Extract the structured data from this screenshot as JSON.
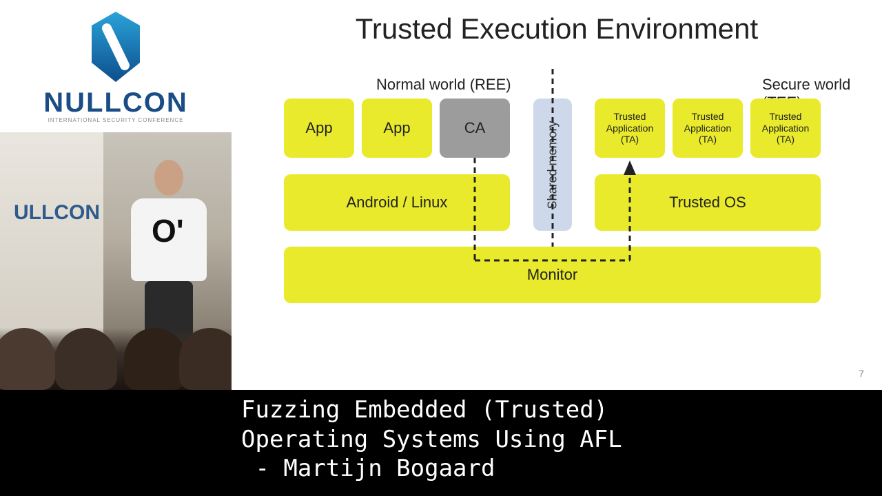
{
  "badge": {
    "word": "NULLCON",
    "subtitle": "INTERNATIONAL SECURITY CONFERENCE"
  },
  "slide": {
    "title": "Trusted Execution Environment",
    "sections": {
      "left": "Normal world (REE)",
      "right": "Secure world (TEE)"
    },
    "boxes": {
      "app1": "App",
      "app2": "App",
      "ca": "CA",
      "ta1_l1": "Trusted",
      "ta1_l2": "Application",
      "ta1_l3": "(TA)",
      "ta2_l1": "Trusted",
      "ta2_l2": "Application",
      "ta2_l3": "(TA)",
      "ta3_l1": "Trusted",
      "ta3_l2": "Application",
      "ta3_l3": "(TA)",
      "os_left": "Android / Linux",
      "os_right": "Trusted OS",
      "monitor": "Monitor",
      "shared": "Shared memory"
    },
    "page_number": "7"
  },
  "caption": {
    "line1": "Fuzzing Embedded (Trusted)",
    "line2": "Operating Systems Using AFL",
    "line3": " - Martijn Bogaard"
  },
  "chart_data": {
    "type": "diagram",
    "title": "Trusted Execution Environment",
    "left_world": {
      "label": "Normal world (REE)",
      "apps": [
        "App",
        "App",
        "CA"
      ],
      "os": "Android / Linux"
    },
    "right_world": {
      "label": "Secure world (TEE)",
      "apps": [
        "Trusted Application (TA)",
        "Trusted Application (TA)",
        "Trusted Application (TA)"
      ],
      "os": "Trusted OS"
    },
    "shared_memory": "Shared memory",
    "monitor": "Monitor",
    "flows": [
      {
        "from": "CA",
        "to": "Monitor",
        "style": "dashed"
      },
      {
        "from": "Monitor",
        "to": "Trusted Application (TA)",
        "style": "dashed-arrow"
      },
      {
        "from": "Shared memory",
        "to": "both-worlds",
        "style": "dashed-vertical"
      }
    ]
  }
}
